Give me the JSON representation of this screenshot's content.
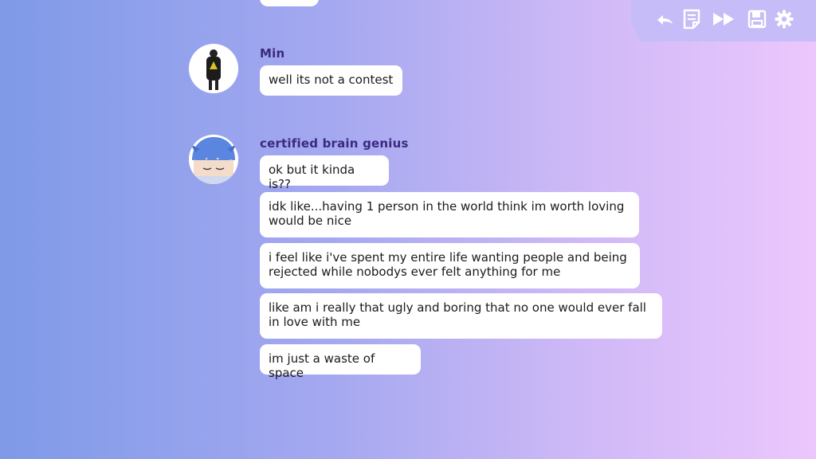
{
  "toolbar": {
    "icons": [
      "back-icon",
      "log-icon",
      "skip-icon",
      "save-icon",
      "settings-icon"
    ]
  },
  "messages": [
    {
      "sender": "Min",
      "lines": [
        "well its not a contest"
      ]
    },
    {
      "sender": "certified brain genius",
      "lines": [
        "ok but it kinda is??",
        "idk like...having 1 person in the world think im worth loving\nwould be nice",
        "i feel like i've spent my entire life wanting people and being\nrejected while nobodys ever felt anything for me",
        "like am i really that ugly and boring that no one would ever fall\nin love with me",
        "im just a waste of space"
      ]
    }
  ],
  "colors": {
    "name_color": "#3a2a80",
    "toolbar_bg": "#c6bcf8",
    "icon_color": "#ffffff"
  }
}
